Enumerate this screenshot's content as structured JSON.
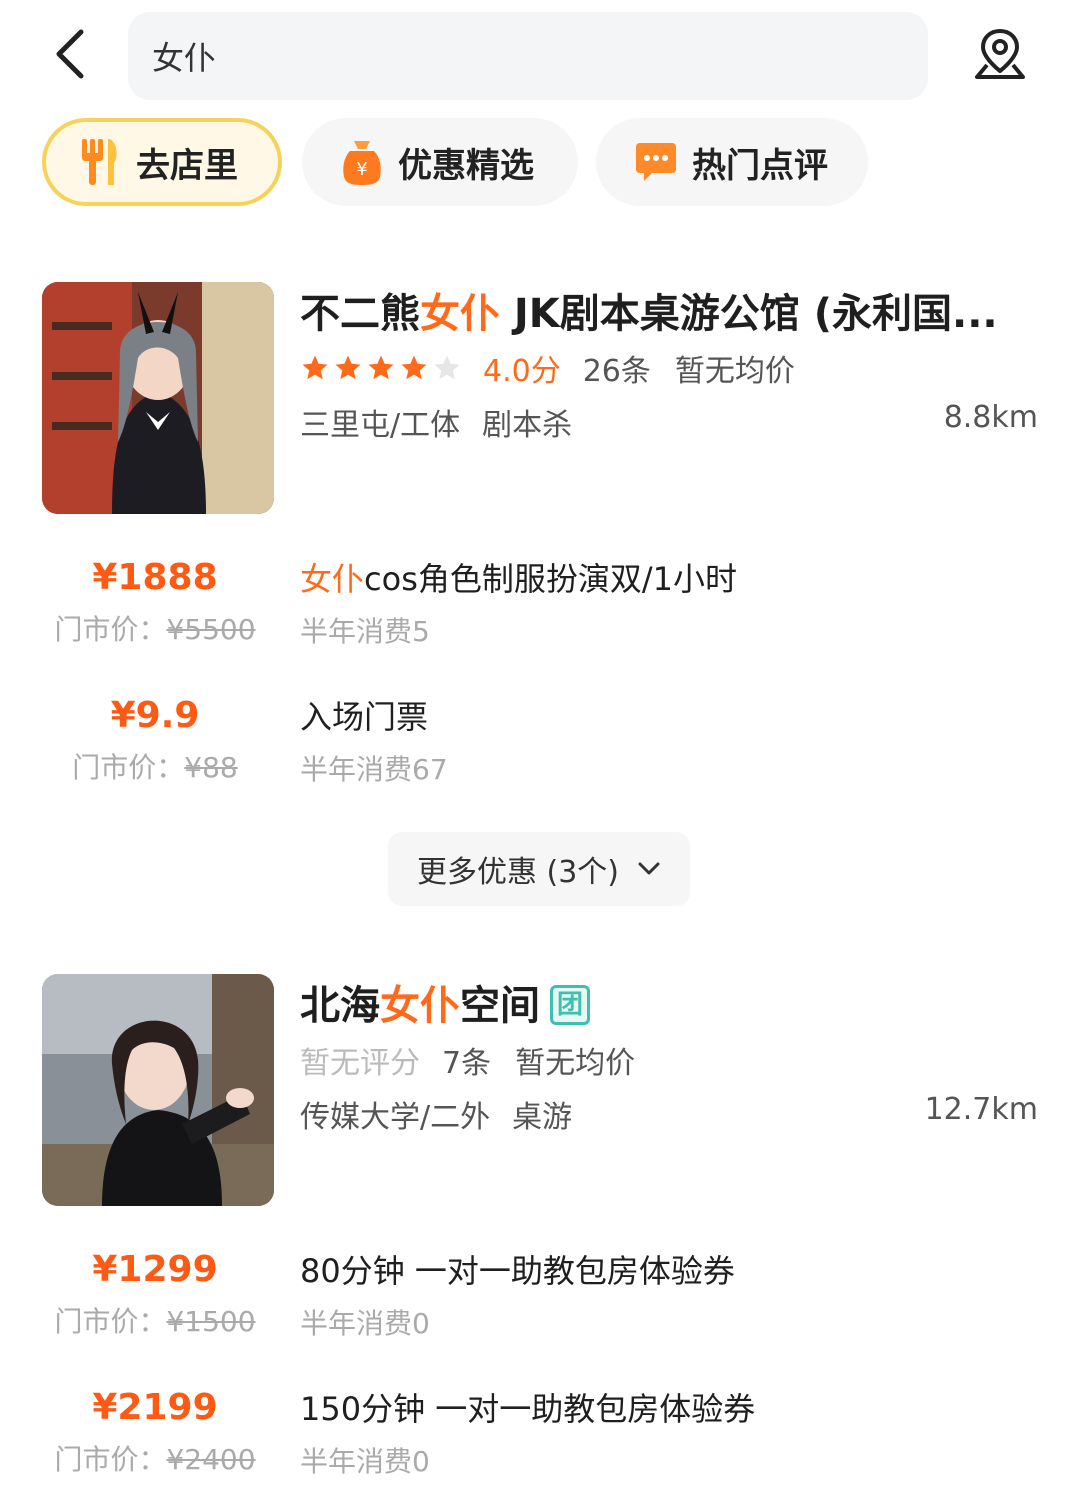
{
  "search": {
    "query": "女仆"
  },
  "chips": [
    {
      "label": "去店里",
      "icon": "fork-knife-icon",
      "active": true
    },
    {
      "label": "优惠精选",
      "icon": "coupon-bag-icon",
      "active": false
    },
    {
      "label": "热门点评",
      "icon": "chat-bubble-icon",
      "active": false
    }
  ],
  "colors": {
    "accent": "#ff6a1a",
    "price": "#ff5a14",
    "active_chip_border": "#f5d35b",
    "tuan_badge": "#3fbfae"
  },
  "shops": [
    {
      "name_prefix": "不二熊",
      "name_highlight": "女仆",
      "name_suffix": " JK剧本桌游公馆 (永利国...",
      "rating_stars": 4,
      "score": "4.0分",
      "reviews": "26条",
      "avg_price": "暂无均价",
      "area": "三里屯/工体",
      "category": "剧本杀",
      "distance": "8.8km",
      "deals": [
        {
          "price": "¥1888",
          "orig_label": "门市价：",
          "orig_price": "¥5500",
          "title_highlight": "女仆",
          "title": "cos角色制服扮演双/1小时",
          "sales": "半年消费5"
        },
        {
          "price": "¥9.9",
          "orig_label": "门市价：",
          "orig_price": "¥88",
          "title_highlight": "",
          "title": "入场门票",
          "sales": "半年消费67"
        }
      ],
      "more": "更多优惠 (3个)"
    },
    {
      "name_prefix": "北海",
      "name_highlight": "女仆",
      "name_suffix": "空间",
      "badge": "团",
      "no_score": "暂无评分",
      "reviews": "7条",
      "avg_price": "暂无均价",
      "area": "传媒大学/二外",
      "category": "桌游",
      "distance": "12.7km",
      "deals": [
        {
          "price": "¥1299",
          "orig_label": "门市价：",
          "orig_price": "¥1500",
          "title": "80分钟 一对一助教包房体验券",
          "sales": "半年消费0"
        },
        {
          "price": "¥2199",
          "orig_label": "门市价：",
          "orig_price": "¥2400",
          "title": "150分钟 一对一助教包房体验券",
          "sales": "半年消费0"
        }
      ]
    }
  ]
}
